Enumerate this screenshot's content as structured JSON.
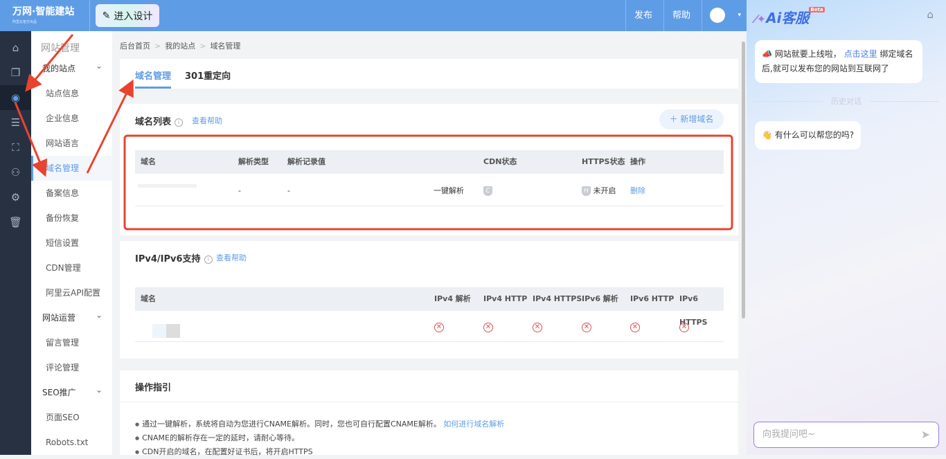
{
  "header": {
    "logo": "万网·智能建站",
    "logo_sub": "阿里云官方出品",
    "design_button": "进入设计",
    "publish": "发布",
    "help": "帮助"
  },
  "rail": {
    "icons": [
      "home-icon",
      "pages-icon",
      "globe-icon",
      "list-icon",
      "shop-icon",
      "users-icon",
      "gear-icon",
      "trash-icon"
    ]
  },
  "submenu": {
    "title": "网站管理",
    "groups": [
      {
        "label": "我的站点",
        "items": [
          "站点信息",
          "企业信息",
          "网站语言",
          "域名管理",
          "备案信息",
          "备份恢复",
          "短信设置",
          "CDN管理",
          "阿里云API配置"
        ]
      },
      {
        "label": "网站运营",
        "items": [
          "留言管理",
          "评论管理"
        ]
      },
      {
        "label": "SEO推广",
        "items": [
          "页面SEO",
          "Robots.txt"
        ]
      }
    ],
    "active": "域名管理"
  },
  "breadcrumb": [
    "后台首页",
    "我的站点",
    "域名管理"
  ],
  "tabs": [
    "域名管理",
    "301重定向"
  ],
  "domain_list": {
    "title": "域名列表",
    "help": "查看帮助",
    "add_button": "新增域名",
    "columns": [
      "域名",
      "解析类型",
      "解析记录值",
      "CDN状态",
      "HTTPS状态",
      "操作"
    ],
    "row": {
      "type": "-",
      "value": "-",
      "action_resolve": "一键解析",
      "cdn_badge": "C",
      "https_badge": "H",
      "https_status": "未开启",
      "delete": "删除"
    }
  },
  "ipv": {
    "title": "IPv4/IPv6支持",
    "help": "查看帮助",
    "columns": [
      "域名",
      "IPv4 解析",
      "IPv4 HTTP",
      "IPv4 HTTPS",
      "IPv6 解析",
      "IPv6 HTTP",
      "IPv6 HTTPS"
    ],
    "status": "✕"
  },
  "guide": {
    "title": "操作指引",
    "items": [
      "通过一键解析，系统将自动为您进行CNAME解析。同时，您也可自行配置CNAME解析。",
      "CNAME的解析存在一定的延时，请耐心等待。",
      "CDN开启的域名，在配置好证书后，将开启HTTPS"
    ],
    "link": "如何进行域名解析"
  },
  "ai": {
    "title": "Ai客服",
    "beta": "Beta",
    "msg1_a": "网站就要上线啦，",
    "msg1_link": "点击这里",
    "msg1_b": "绑定域名后,就可以发布您的网站到互联网了",
    "history": "历史对话",
    "msg2": "有什么可以帮您的吗?",
    "input_placeholder": "向我提问吧~"
  },
  "colors": {
    "primary": "#5f9ce6",
    "annotation": "#e8432e"
  }
}
